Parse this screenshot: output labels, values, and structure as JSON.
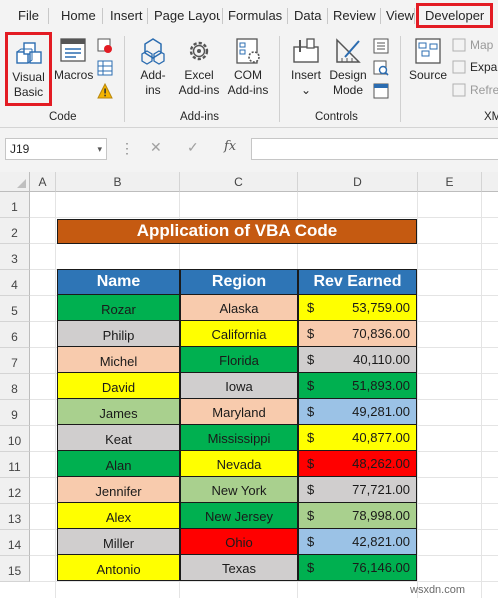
{
  "ribbon_tabs": [
    "File",
    "Home",
    "Insert",
    "Page Layout",
    "Formulas",
    "Data",
    "Review",
    "View",
    "Developer"
  ],
  "ribbon": {
    "code_group": {
      "label": "Code",
      "visual_basic_line1": "Visual",
      "visual_basic_line2": "Basic",
      "macros": "Macros"
    },
    "addins_group": {
      "label": "Add-ins",
      "addins_line1": "Add-",
      "addins_line2": "ins",
      "excel_addins_line1": "Excel",
      "excel_addins_line2": "Add-ins",
      "com_addins_line1": "COM",
      "com_addins_line2": "Add-ins"
    },
    "controls_group": {
      "label": "Controls",
      "insert": "Insert",
      "insert_caret": "⌄",
      "design_mode_line1": "Design",
      "design_mode_line2": "Mode"
    },
    "xml_group": {
      "label": "XM",
      "source": "Source",
      "map": "Map",
      "expand": "Expa",
      "refresh": "Refre"
    }
  },
  "formula_bar": {
    "name_box": "J19",
    "name_box_arrow": "▾",
    "dots": "⋮",
    "cancel": "✕",
    "enter": "✓",
    "fx": "fx",
    "formula": ""
  },
  "columns": [
    "A",
    "B",
    "C",
    "D",
    "E"
  ],
  "rows": [
    "1",
    "2",
    "3",
    "4",
    "5",
    "6",
    "7",
    "8",
    "9",
    "10",
    "11",
    "12",
    "13",
    "14",
    "15"
  ],
  "sheet": {
    "title": "Application of VBA Code",
    "headers": [
      "Name",
      "Region",
      "Rev Earned"
    ],
    "currency_symbol": "$",
    "records": [
      {
        "name": "Rozar",
        "region": "Alaska",
        "rev": "53,759.00",
        "name_bg": "#00b050",
        "region_bg": "#f8cbad",
        "rev_bg": "#ffff00"
      },
      {
        "name": "Philip",
        "region": "California",
        "rev": "70,836.00",
        "name_bg": "#d0cece",
        "region_bg": "#ffff00",
        "rev_bg": "#f8cbad"
      },
      {
        "name": "Michel",
        "region": "Florida",
        "rev": "40,110.00",
        "name_bg": "#f8cbad",
        "region_bg": "#00b050",
        "rev_bg": "#d0cece"
      },
      {
        "name": "David",
        "region": "Iowa",
        "rev": "51,893.00",
        "name_bg": "#ffff00",
        "region_bg": "#d0cece",
        "rev_bg": "#00b050"
      },
      {
        "name": "James",
        "region": "Maryland",
        "rev": "49,281.00",
        "name_bg": "#a9d08e",
        "region_bg": "#f8cbad",
        "rev_bg": "#9bc2e6"
      },
      {
        "name": "Keat",
        "region": "Mississippi",
        "rev": "40,877.00",
        "name_bg": "#d0cece",
        "region_bg": "#00b050",
        "rev_bg": "#ffff00"
      },
      {
        "name": "Alan",
        "region": "Nevada",
        "rev": "48,262.00",
        "name_bg": "#00b050",
        "region_bg": "#ffff00",
        "rev_bg": "#ff0000"
      },
      {
        "name": "Jennifer",
        "region": "New York",
        "rev": "77,721.00",
        "name_bg": "#f8cbad",
        "region_bg": "#a9d08e",
        "rev_bg": "#d0cece"
      },
      {
        "name": "Alex",
        "region": "New Jersey",
        "rev": "78,998.00",
        "name_bg": "#ffff00",
        "region_bg": "#00b050",
        "rev_bg": "#a9d08e"
      },
      {
        "name": "Miller",
        "region": "Ohio",
        "rev": "42,821.00",
        "name_bg": "#d0cece",
        "region_bg": "#ff0000",
        "rev_bg": "#9bc2e6"
      },
      {
        "name": "Antonio",
        "region": "Texas",
        "rev": "76,146.00",
        "name_bg": "#ffff00",
        "region_bg": "#d0cece",
        "rev_bg": "#00b050"
      }
    ]
  },
  "colors": {
    "title_fill": "#c55a11",
    "header_fill": "#2e75b6",
    "highlight_border": "#e31b23"
  },
  "watermark": "wsxdn.com"
}
